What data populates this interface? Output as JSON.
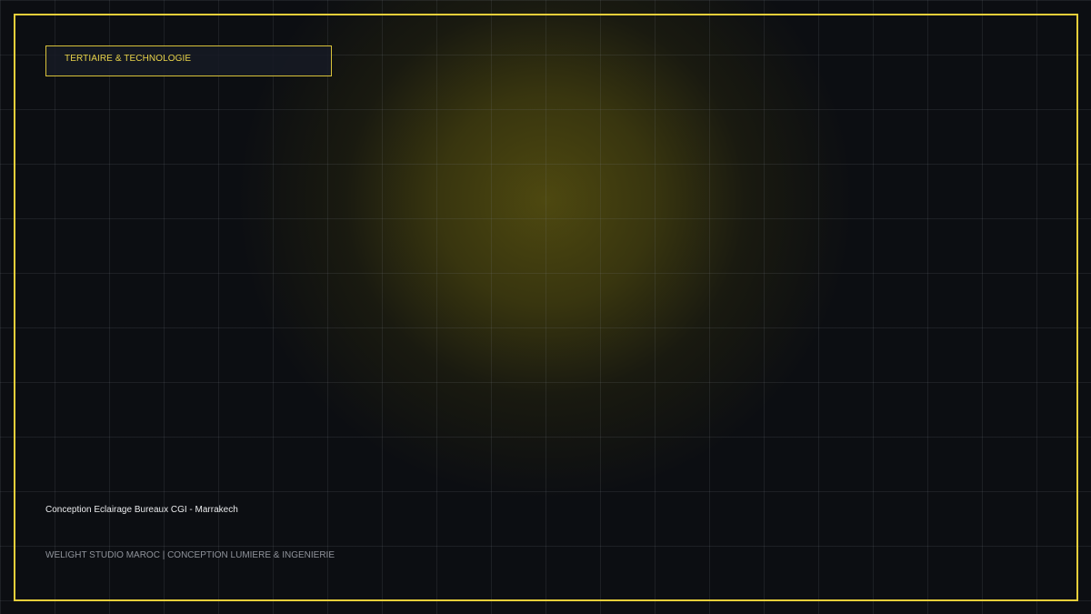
{
  "tag": {
    "label": "TERTIAIRE & TECHNOLOGIE"
  },
  "project": {
    "title": "Conception Eclairage Bureaux CGI - Marrakech"
  },
  "footer": {
    "text": "WELIGHT STUDIO MAROC | CONCEPTION LUMIERE & INGENIERIE"
  },
  "colors": {
    "background": "#0c0e12",
    "accent": "#e8cf3a",
    "glow": "#766c0e"
  }
}
